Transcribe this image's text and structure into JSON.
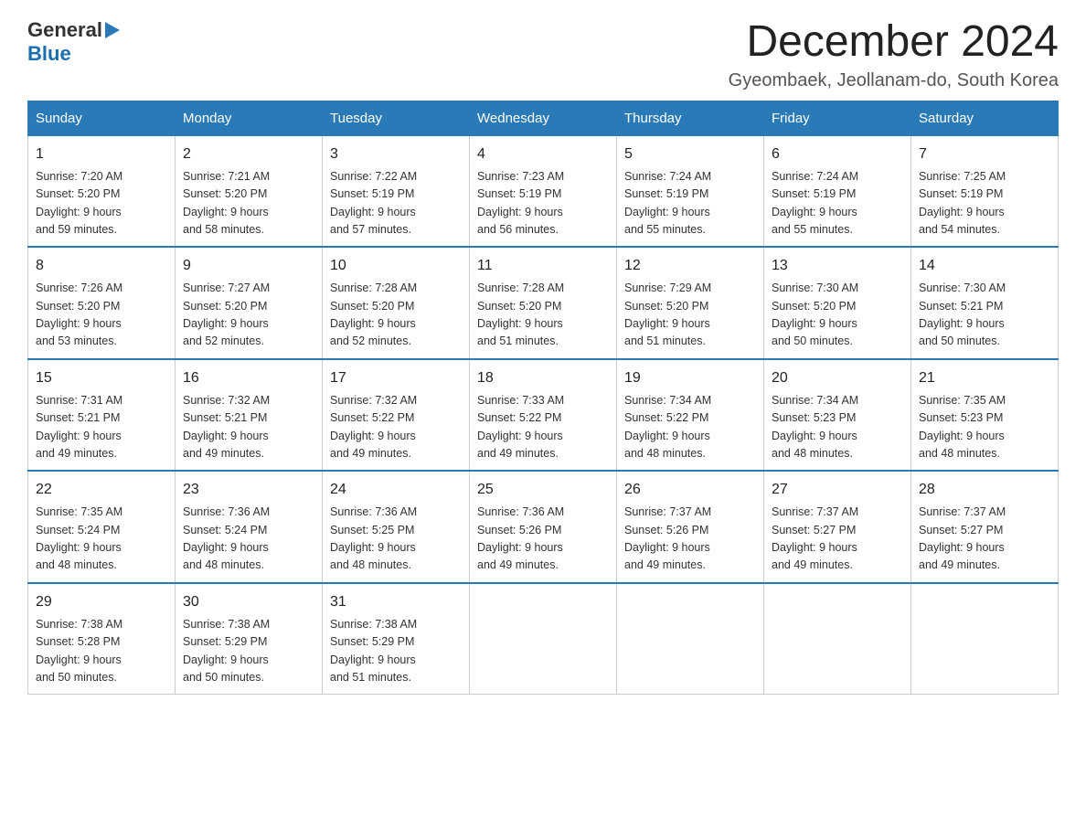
{
  "header": {
    "logo_general": "General",
    "logo_blue": "Blue",
    "month_title": "December 2024",
    "location": "Gyeombaek, Jeollanam-do, South Korea"
  },
  "weekdays": [
    "Sunday",
    "Monday",
    "Tuesday",
    "Wednesday",
    "Thursday",
    "Friday",
    "Saturday"
  ],
  "weeks": [
    [
      {
        "day": "1",
        "sunrise": "7:20 AM",
        "sunset": "5:20 PM",
        "daylight": "9 hours and 59 minutes."
      },
      {
        "day": "2",
        "sunrise": "7:21 AM",
        "sunset": "5:20 PM",
        "daylight": "9 hours and 58 minutes."
      },
      {
        "day": "3",
        "sunrise": "7:22 AM",
        "sunset": "5:19 PM",
        "daylight": "9 hours and 57 minutes."
      },
      {
        "day": "4",
        "sunrise": "7:23 AM",
        "sunset": "5:19 PM",
        "daylight": "9 hours and 56 minutes."
      },
      {
        "day": "5",
        "sunrise": "7:24 AM",
        "sunset": "5:19 PM",
        "daylight": "9 hours and 55 minutes."
      },
      {
        "day": "6",
        "sunrise": "7:24 AM",
        "sunset": "5:19 PM",
        "daylight": "9 hours and 55 minutes."
      },
      {
        "day": "7",
        "sunrise": "7:25 AM",
        "sunset": "5:19 PM",
        "daylight": "9 hours and 54 minutes."
      }
    ],
    [
      {
        "day": "8",
        "sunrise": "7:26 AM",
        "sunset": "5:20 PM",
        "daylight": "9 hours and 53 minutes."
      },
      {
        "day": "9",
        "sunrise": "7:27 AM",
        "sunset": "5:20 PM",
        "daylight": "9 hours and 52 minutes."
      },
      {
        "day": "10",
        "sunrise": "7:28 AM",
        "sunset": "5:20 PM",
        "daylight": "9 hours and 52 minutes."
      },
      {
        "day": "11",
        "sunrise": "7:28 AM",
        "sunset": "5:20 PM",
        "daylight": "9 hours and 51 minutes."
      },
      {
        "day": "12",
        "sunrise": "7:29 AM",
        "sunset": "5:20 PM",
        "daylight": "9 hours and 51 minutes."
      },
      {
        "day": "13",
        "sunrise": "7:30 AM",
        "sunset": "5:20 PM",
        "daylight": "9 hours and 50 minutes."
      },
      {
        "day": "14",
        "sunrise": "7:30 AM",
        "sunset": "5:21 PM",
        "daylight": "9 hours and 50 minutes."
      }
    ],
    [
      {
        "day": "15",
        "sunrise": "7:31 AM",
        "sunset": "5:21 PM",
        "daylight": "9 hours and 49 minutes."
      },
      {
        "day": "16",
        "sunrise": "7:32 AM",
        "sunset": "5:21 PM",
        "daylight": "9 hours and 49 minutes."
      },
      {
        "day": "17",
        "sunrise": "7:32 AM",
        "sunset": "5:22 PM",
        "daylight": "9 hours and 49 minutes."
      },
      {
        "day": "18",
        "sunrise": "7:33 AM",
        "sunset": "5:22 PM",
        "daylight": "9 hours and 49 minutes."
      },
      {
        "day": "19",
        "sunrise": "7:34 AM",
        "sunset": "5:22 PM",
        "daylight": "9 hours and 48 minutes."
      },
      {
        "day": "20",
        "sunrise": "7:34 AM",
        "sunset": "5:23 PM",
        "daylight": "9 hours and 48 minutes."
      },
      {
        "day": "21",
        "sunrise": "7:35 AM",
        "sunset": "5:23 PM",
        "daylight": "9 hours and 48 minutes."
      }
    ],
    [
      {
        "day": "22",
        "sunrise": "7:35 AM",
        "sunset": "5:24 PM",
        "daylight": "9 hours and 48 minutes."
      },
      {
        "day": "23",
        "sunrise": "7:36 AM",
        "sunset": "5:24 PM",
        "daylight": "9 hours and 48 minutes."
      },
      {
        "day": "24",
        "sunrise": "7:36 AM",
        "sunset": "5:25 PM",
        "daylight": "9 hours and 48 minutes."
      },
      {
        "day": "25",
        "sunrise": "7:36 AM",
        "sunset": "5:26 PM",
        "daylight": "9 hours and 49 minutes."
      },
      {
        "day": "26",
        "sunrise": "7:37 AM",
        "sunset": "5:26 PM",
        "daylight": "9 hours and 49 minutes."
      },
      {
        "day": "27",
        "sunrise": "7:37 AM",
        "sunset": "5:27 PM",
        "daylight": "9 hours and 49 minutes."
      },
      {
        "day": "28",
        "sunrise": "7:37 AM",
        "sunset": "5:27 PM",
        "daylight": "9 hours and 49 minutes."
      }
    ],
    [
      {
        "day": "29",
        "sunrise": "7:38 AM",
        "sunset": "5:28 PM",
        "daylight": "9 hours and 50 minutes."
      },
      {
        "day": "30",
        "sunrise": "7:38 AM",
        "sunset": "5:29 PM",
        "daylight": "9 hours and 50 minutes."
      },
      {
        "day": "31",
        "sunrise": "7:38 AM",
        "sunset": "5:29 PM",
        "daylight": "9 hours and 51 minutes."
      },
      null,
      null,
      null,
      null
    ]
  ],
  "labels": {
    "sunrise": "Sunrise:",
    "sunset": "Sunset:",
    "daylight": "Daylight:"
  }
}
